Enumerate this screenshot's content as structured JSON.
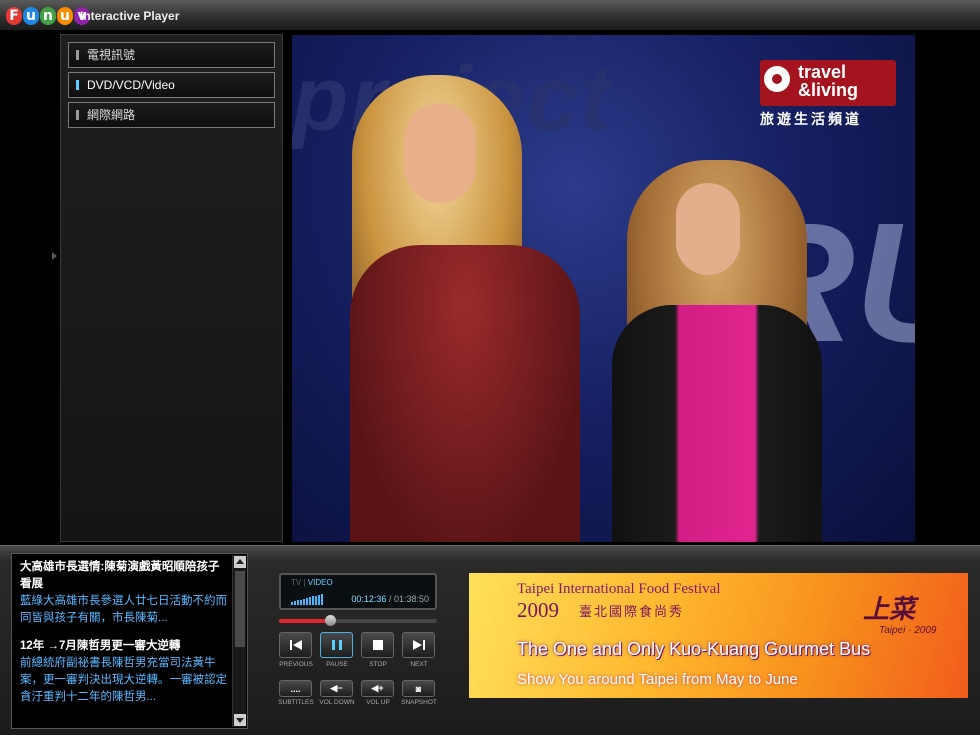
{
  "app": {
    "logo_letters": [
      "F",
      "u",
      "n",
      "u",
      "v"
    ],
    "logo_colors": [
      "#e53935",
      "#1e88e5",
      "#43a047",
      "#fb8c00",
      "#8e24aa"
    ],
    "title": "Interactive Player"
  },
  "sidebar": {
    "items": [
      {
        "label": "電視訊號",
        "active": false
      },
      {
        "label": "DVD/VCD/Video",
        "active": true
      },
      {
        "label": "網際網路",
        "active": false
      }
    ]
  },
  "video": {
    "channel_logo_line1": "travel",
    "channel_logo_line2": "&living",
    "channel_subtitle": "旅遊生活頻道",
    "background_words": [
      "project",
      "RUNW"
    ]
  },
  "news": {
    "items": [
      {
        "title": "大高雄市長選情:陳菊演戲黃昭順陪孩子看展",
        "body": "藍綠大高雄市長參選人廿七日活動不約而同皆與孩子有關，市長陳菊..."
      },
      {
        "title": "12年 →7月陳哲男更一審大逆轉",
        "body": "前總統府副祕書長陳哲男充當司法黃牛案，更一審判決出現大逆轉。一審被認定貪汙重判十二年的陳哲男..."
      }
    ]
  },
  "player": {
    "mode_inactive": "TV",
    "mode_separator": "|",
    "mode_active": "VIDEO",
    "current_time": "00:12:36",
    "duration": "/ 01:38:50",
    "progress_fraction": 0.32,
    "volume_bars": 11,
    "buttons": [
      {
        "id": "previous",
        "label": "PREVIOUS",
        "icon": "previous-icon"
      },
      {
        "id": "pause",
        "label": "PAUSE",
        "icon": "pause-icon"
      },
      {
        "id": "stop",
        "label": "STOP",
        "icon": "stop-icon"
      },
      {
        "id": "next",
        "label": "NEXT",
        "icon": "next-icon"
      }
    ],
    "small_buttons": [
      {
        "id": "subtitles",
        "label": "SUBTITLES",
        "glyph": "....",
        "icon": "subtitles-icon"
      },
      {
        "id": "vol-down",
        "label": "VOL DOWN",
        "glyph": "◀−",
        "icon": "volume-down-icon"
      },
      {
        "id": "vol-up",
        "label": "VOL UP",
        "glyph": "◀+",
        "icon": "volume-up-icon"
      },
      {
        "id": "snapshot",
        "label": "SNAPSHOT",
        "glyph": "◙",
        "icon": "camera-icon"
      }
    ]
  },
  "ad": {
    "title": "Taipei International  Food Festival",
    "year": "2009",
    "title_zh": "臺北國際食尚秀",
    "line1": "The One and Only Kuo-Kuang  Gourmet Bus",
    "line2": "Show You around Taipei from  May to June",
    "brand": "上菜",
    "brand_sub": "Taipei · 2009",
    "colors": {
      "primary": "#7a1660",
      "background": "#ffb62e"
    }
  }
}
